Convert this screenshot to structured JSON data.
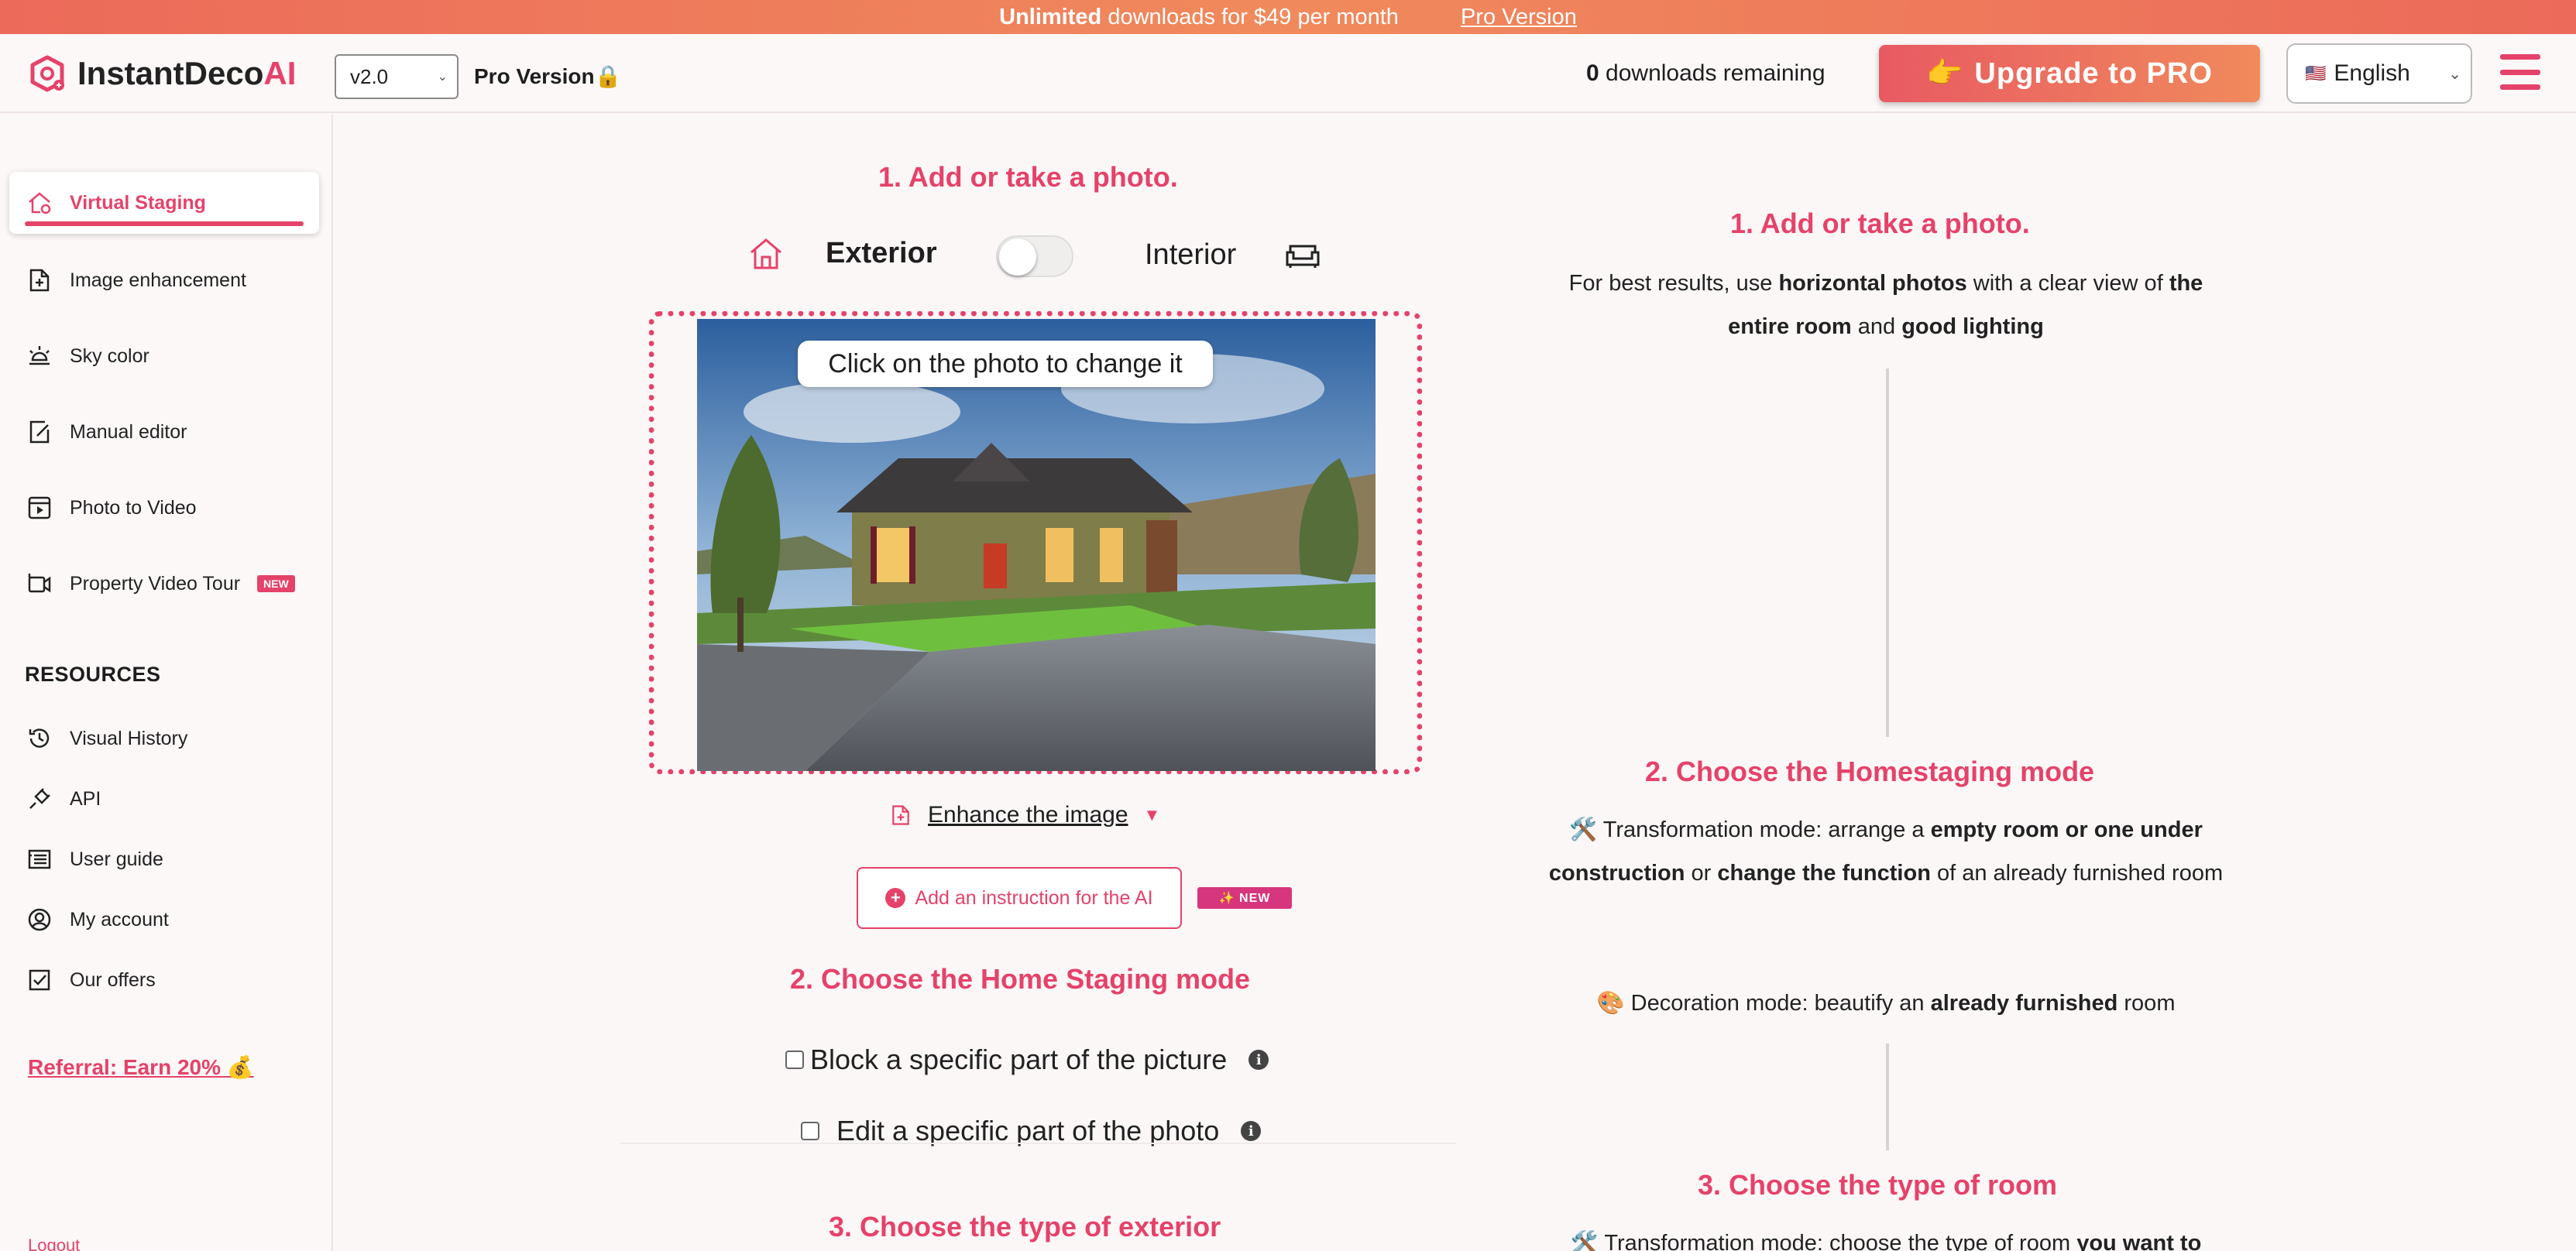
{
  "banner": {
    "strong": "Unlimited",
    "text": "downloads for $49 per month",
    "link": "Pro Version"
  },
  "header": {
    "brand": "InstantDeco",
    "brand_accent": "AI",
    "version": "v2.0",
    "pro_label": "Pro Version🔒",
    "downloads_count": "0",
    "downloads_text": "downloads remaining",
    "upgrade_icon": "👉",
    "upgrade_label": "Upgrade to PRO",
    "language_flag": "🇺🇸",
    "language": "English"
  },
  "sidebar": {
    "items": [
      {
        "label": "Virtual Staging"
      },
      {
        "label": "Image enhancement"
      },
      {
        "label": "Sky color"
      },
      {
        "label": "Manual editor"
      },
      {
        "label": "Photo to Video"
      },
      {
        "label": "Property Video Tour",
        "badge": "NEW"
      }
    ],
    "resources_title": "RESOURCES",
    "resources": [
      {
        "label": "Visual History"
      },
      {
        "label": "API"
      },
      {
        "label": "User guide"
      },
      {
        "label": "My account"
      },
      {
        "label": "Our offers"
      }
    ],
    "referral": "Referral: Earn 20% 💰",
    "logout": "Logout"
  },
  "main": {
    "step1_title": "1. Add or take a photo.",
    "exterior_label": "Exterior",
    "interior_label": "Interior",
    "photo_hint": "Click on the photo to change it",
    "enhance_label": "Enhance the image",
    "instruction_button": "Add an instruction for the AI",
    "instruction_badge": "✨ NEW",
    "step2_title": "2. Choose the Home Staging mode",
    "block_label": "Block a specific part of the picture",
    "edit_label": "Edit a specific part of the photo",
    "step3_title": "3. Choose the type of exterior"
  },
  "guide": {
    "step1_title": "1. Add or take a photo.",
    "step1_text_a": "For best results, use ",
    "step1_bold_a": "horizontal photos",
    "step1_text_b": " with a clear view of ",
    "step1_bold_b": "the entire room",
    "step1_text_c": " and ",
    "step1_bold_c": "good lighting",
    "step2_title": "2. Choose the Homestaging mode",
    "step2_line1_a": "🛠️ Transformation mode: arrange a ",
    "step2_line1_b": "empty room or one under construction",
    "step2_line1_c": " or ",
    "step2_line1_d": "change the function",
    "step2_line1_e": " of an already furnished room",
    "step2_line2_a": "🎨 Decoration mode: beautify an ",
    "step2_line2_b": "already furnished",
    "step2_line2_c": " room",
    "step3_title": "3. Choose the type of room",
    "step3_text_a": "🛠️ Transformation mode: choose the type of room ",
    "step3_text_b": "you want to"
  },
  "colors": {
    "accent": "#e5426a",
    "banner": "#ec6a5a"
  }
}
